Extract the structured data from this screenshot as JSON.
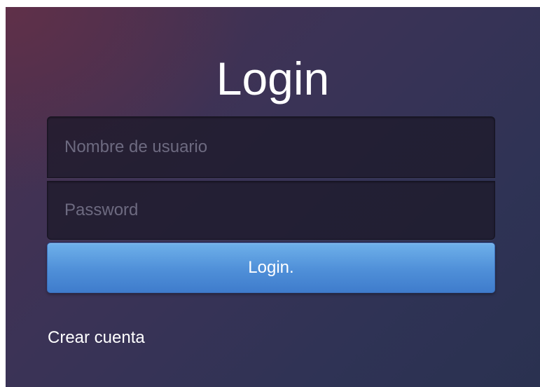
{
  "login_form": {
    "title": "Login",
    "username_placeholder": "Nombre de usuario",
    "password_placeholder": "Password",
    "submit_label": "Login.",
    "create_account_link": "Crear cuenta"
  },
  "colors": {
    "background": "#352f52",
    "button": "#4f8fd8",
    "text": "#ffffff"
  }
}
